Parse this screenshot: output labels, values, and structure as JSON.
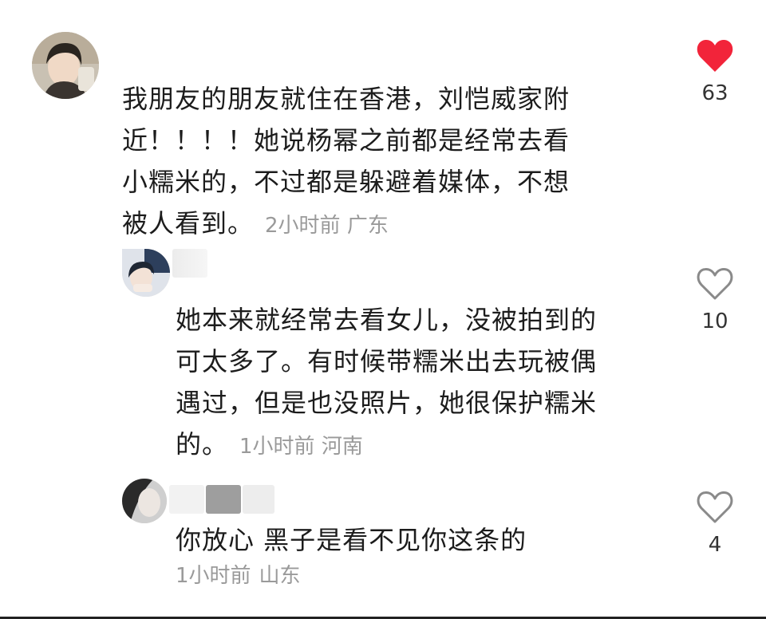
{
  "comments": [
    {
      "text_lines": [
        "我朋友的朋友就住在香港，刘恺威家附",
        "近！！！！她说杨幂之前都是经常去看",
        "小糯米的，不过都是躲避着媒体，不想",
        "被人看到。"
      ],
      "time": "2小时前",
      "location": "广东",
      "like_count": "63",
      "liked": true
    },
    {
      "text_lines": [
        "她本来就经常去看女儿，没被拍到的",
        "可太多了。有时候带糯米出去玩被偶",
        "遇过，但是也没照片，她很保护糯米",
        "的。"
      ],
      "time": "1小时前",
      "location": "河南",
      "like_count": "10",
      "liked": false
    },
    {
      "text_lines": [
        "你放心 黑子是看不见你这条的"
      ],
      "time": "1小时前",
      "location": "山东",
      "like_count": "4",
      "liked": false
    }
  ],
  "colors": {
    "like_active": "#f2243a",
    "like_inactive": "#8a8a8a",
    "meta_text": "#9a9a9a"
  },
  "icons": {
    "liked": "heart-filled-icon",
    "unliked": "heart-outline-icon"
  }
}
